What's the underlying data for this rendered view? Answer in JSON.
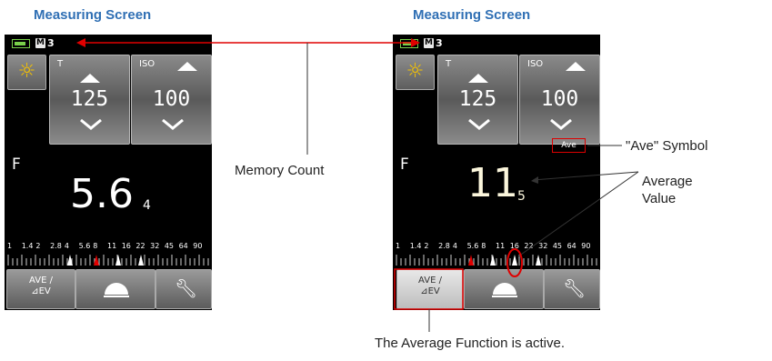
{
  "screens": [
    {
      "title": "Measuring Screen",
      "memory_badge": "M",
      "memory_count": "3",
      "shutter": {
        "label": "T",
        "value": "125"
      },
      "iso": {
        "label": "ISO",
        "value": "100"
      },
      "f_label": "F",
      "f_value": "5.6",
      "f_value_sub": "4",
      "scale_labels": [
        "1",
        "1.4",
        "2",
        "2.8",
        "4",
        "5.6",
        "8",
        "11",
        "16",
        "22",
        "32",
        "45",
        "64",
        "90"
      ],
      "ave_button": {
        "line1": "AVE /",
        "line2": "⊿EV"
      }
    },
    {
      "title": "Measuring Screen",
      "memory_badge": "M",
      "memory_count": "3",
      "shutter": {
        "label": "T",
        "value": "125"
      },
      "iso": {
        "label": "ISO",
        "value": "100"
      },
      "ave_symbol": "Ave",
      "f_label": "F",
      "f_value": "11",
      "f_value_sub": "5",
      "scale_labels": [
        "1",
        "1.4",
        "2",
        "2.8",
        "4",
        "5.6",
        "8",
        "11",
        "16",
        "22",
        "32",
        "45",
        "64",
        "90"
      ],
      "ave_button": {
        "line1": "AVE /",
        "line2": "⊿EV"
      }
    }
  ],
  "callouts": {
    "memory_count": "Memory Count",
    "ave_symbol": "\"Ave\" Symbol",
    "average_value_1": "Average",
    "average_value_2": "Value",
    "average_function": "The Average Function is active."
  },
  "colors": {
    "title_blue": "#2f6fb4",
    "highlight_red": "#e00000",
    "battery_green": "#7ad14a"
  },
  "icons": {
    "light_mode": "sun-icon",
    "incident_dome": "dome-icon",
    "settings": "wrench-icon"
  }
}
